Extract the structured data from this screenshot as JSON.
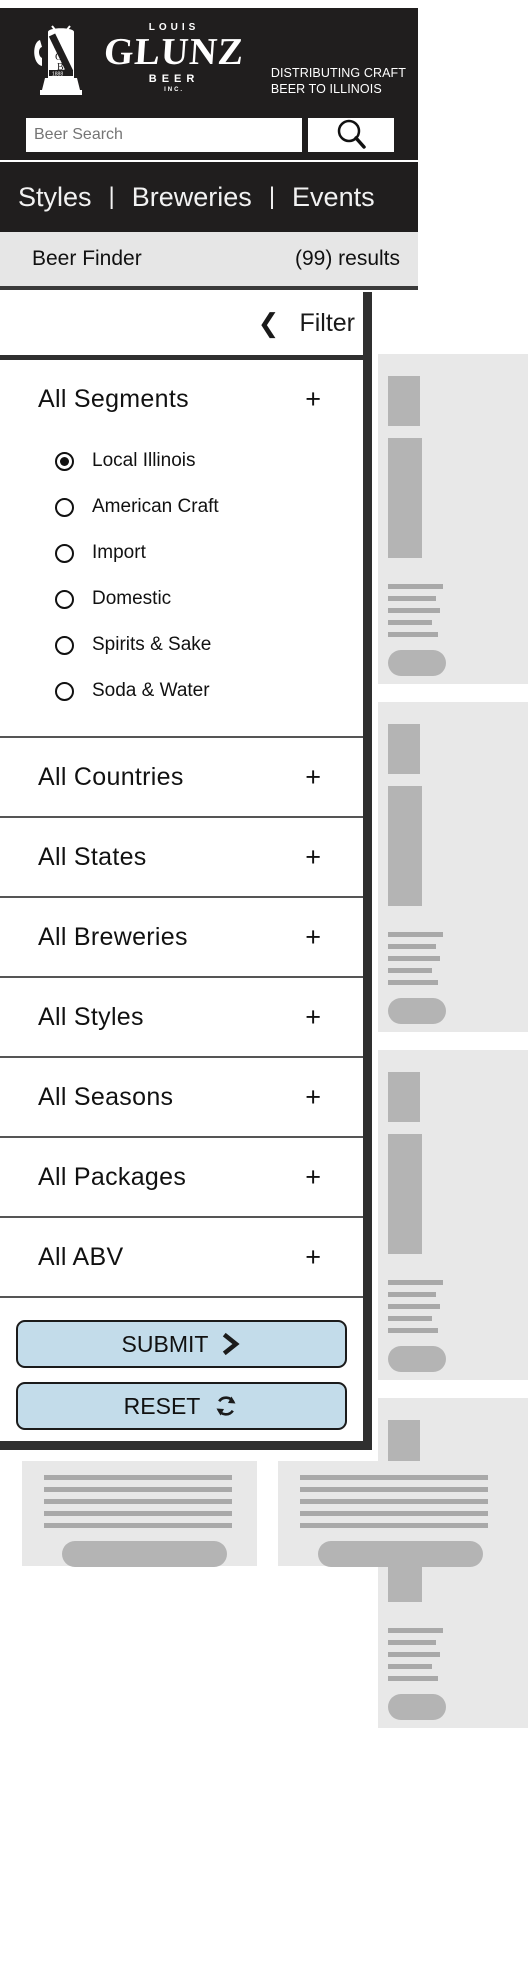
{
  "brand": {
    "logo_top": "LOUIS",
    "logo_main": "GLUNZ",
    "logo_sub": "BEER",
    "logo_inc": "INC.",
    "stein_initials": "LGBI",
    "stein_year": "1888",
    "tagline_line1": "DISTRIBUTING CRAFT",
    "tagline_line2": "BEER TO ILLINOIS"
  },
  "search": {
    "placeholder": "Beer Search",
    "value": "",
    "icon": "search-icon"
  },
  "nav": {
    "items": [
      {
        "label": "Styles"
      },
      {
        "label": "Breweries"
      },
      {
        "label": "Events"
      }
    ],
    "separator": "|"
  },
  "subbar": {
    "title": "Beer Finder",
    "results": "(99) results"
  },
  "filter": {
    "back_icon": "chevron-left-icon",
    "title": "Filter",
    "sections": [
      {
        "title": "All Segments",
        "toggle": "+",
        "expanded": true,
        "options": [
          {
            "label": "Local Illinois",
            "selected": true
          },
          {
            "label": "American Craft",
            "selected": false
          },
          {
            "label": "Import",
            "selected": false
          },
          {
            "label": "Domestic",
            "selected": false
          },
          {
            "label": "Spirits & Sake",
            "selected": false
          },
          {
            "label": "Soda & Water",
            "selected": false
          }
        ]
      },
      {
        "title": "All Countries",
        "toggle": "+",
        "expanded": false,
        "options": []
      },
      {
        "title": "All States",
        "toggle": "+",
        "expanded": false,
        "options": []
      },
      {
        "title": "All Breweries",
        "toggle": "+",
        "expanded": false,
        "options": []
      },
      {
        "title": "All Styles",
        "toggle": "+",
        "expanded": false,
        "options": []
      },
      {
        "title": "All Seasons",
        "toggle": "+",
        "expanded": false,
        "options": []
      },
      {
        "title": "All Packages",
        "toggle": "+",
        "expanded": false,
        "options": []
      },
      {
        "title": "All ABV",
        "toggle": "+",
        "expanded": false,
        "options": []
      }
    ],
    "submit_label": "SUBMIT",
    "submit_icon": "chevron-right-icon",
    "reset_label": "RESET",
    "reset_icon": "refresh-icon"
  },
  "colors": {
    "header_bg": "#201e1e",
    "subbar_bg": "#e6e6e6",
    "overlay_border": "#2f2f2f",
    "button_bg": "#c3dcea",
    "card_bg": "#e8e8e8",
    "placeholder_gray": "#b4b4b4"
  }
}
